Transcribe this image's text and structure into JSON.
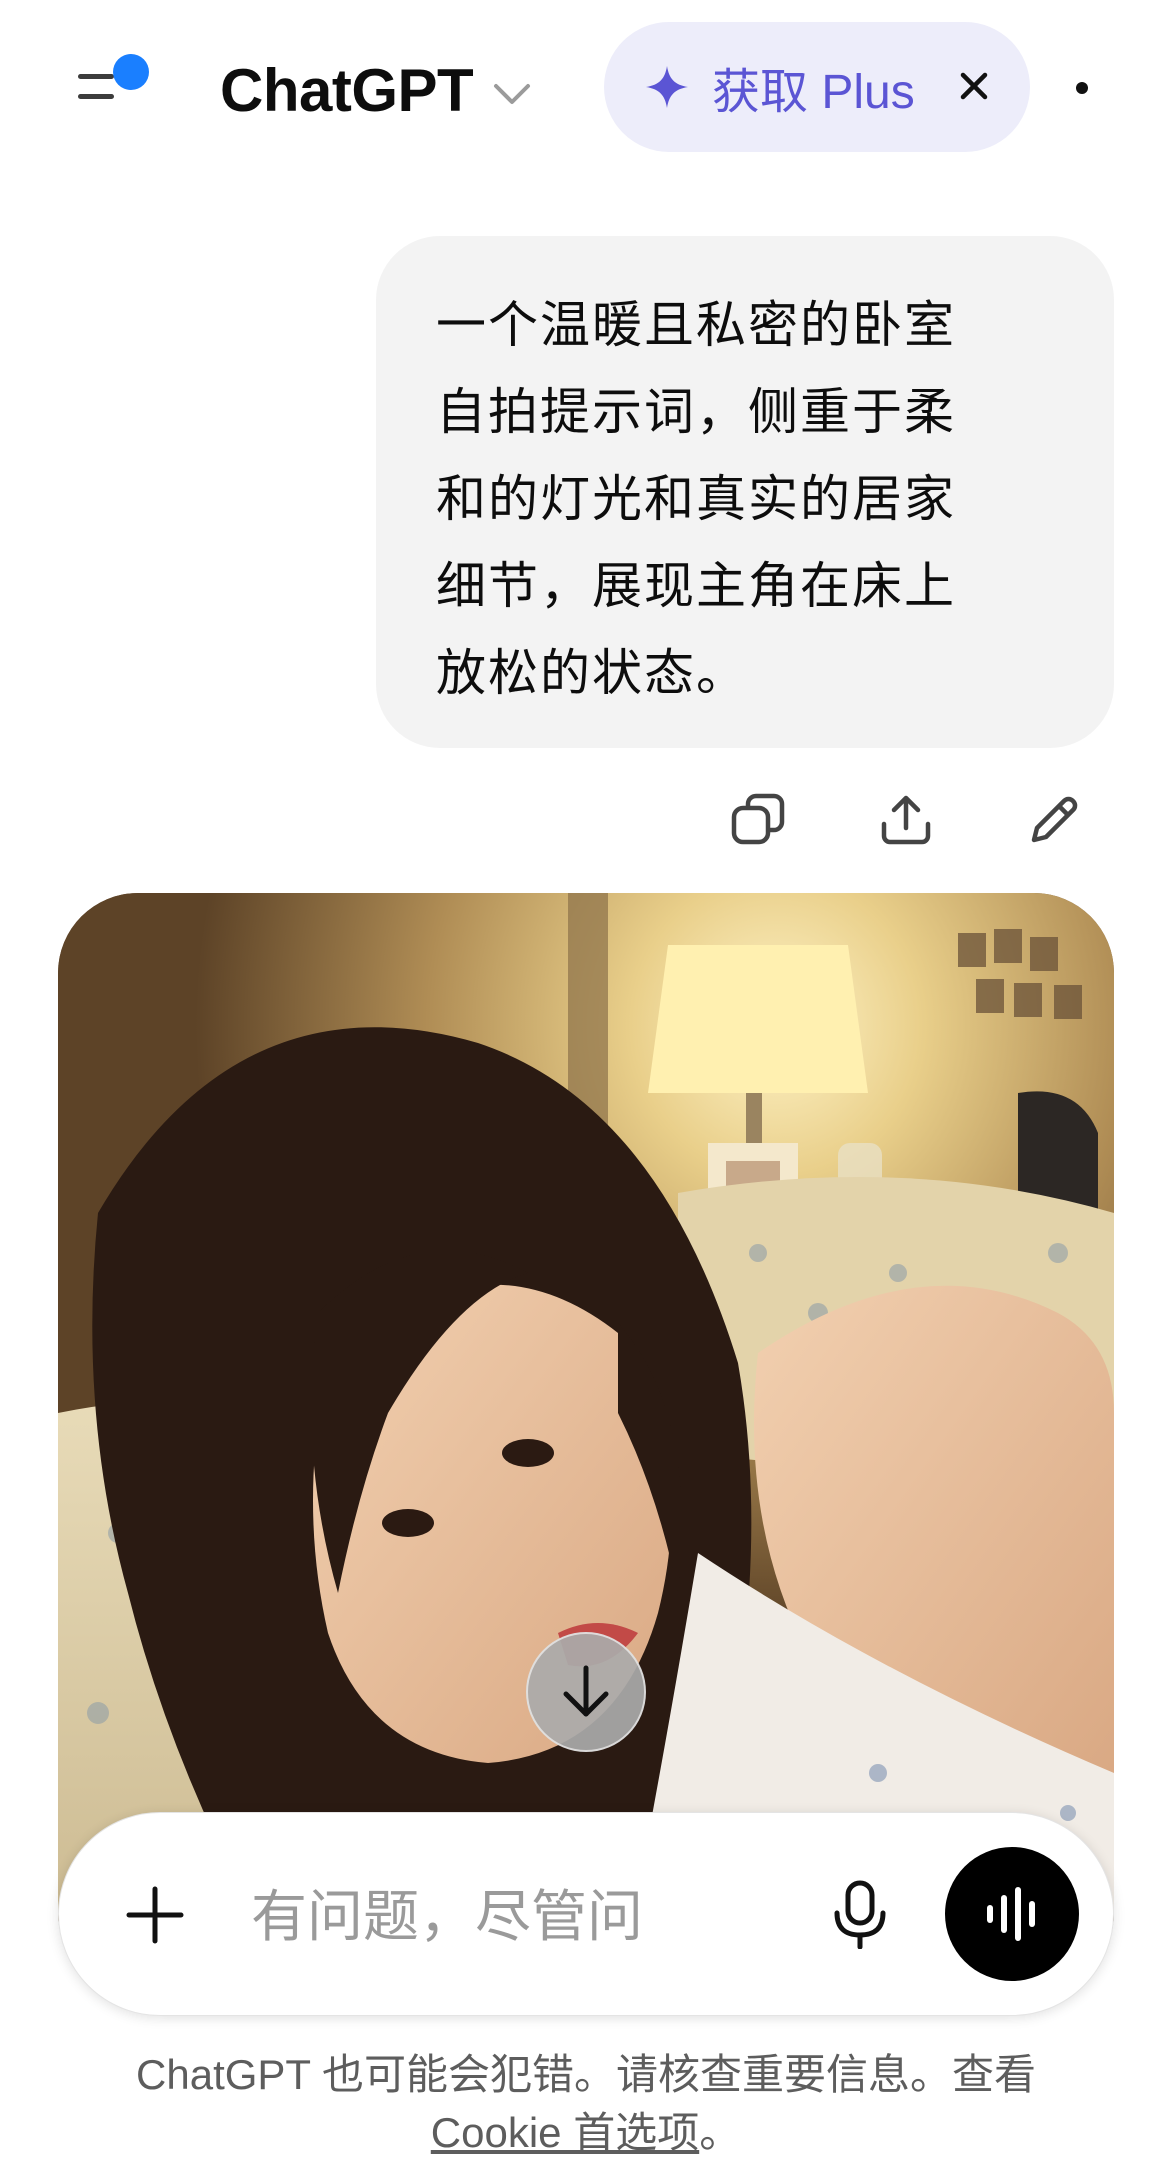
{
  "header": {
    "title": "ChatGPT",
    "upgrade_label": "获取 Plus",
    "icons": [
      "menu-icon",
      "chevron-down-icon",
      "sparkle-icon",
      "close-icon",
      "more-icon"
    ],
    "accent": "#5b55d4",
    "notification_color": "#1a7fff"
  },
  "conversation": {
    "user_message": "一个温暖且私密的卧室\n自拍提示词，侧重于柔\n和的灯光和真实的居家\n细节，展现主角在床上\n放松的状态。",
    "message_actions": [
      "copy-icon",
      "share-icon",
      "edit-icon"
    ]
  },
  "composer": {
    "placeholder": "有问题，尽管问",
    "icons": [
      "plus-icon",
      "microphone-icon",
      "voice-waveform-icon"
    ]
  },
  "footer": {
    "disclaimer": "ChatGPT 也可能会犯错。请核查重要信息。查看",
    "link": "Cookie 首选项",
    "end": "。"
  }
}
